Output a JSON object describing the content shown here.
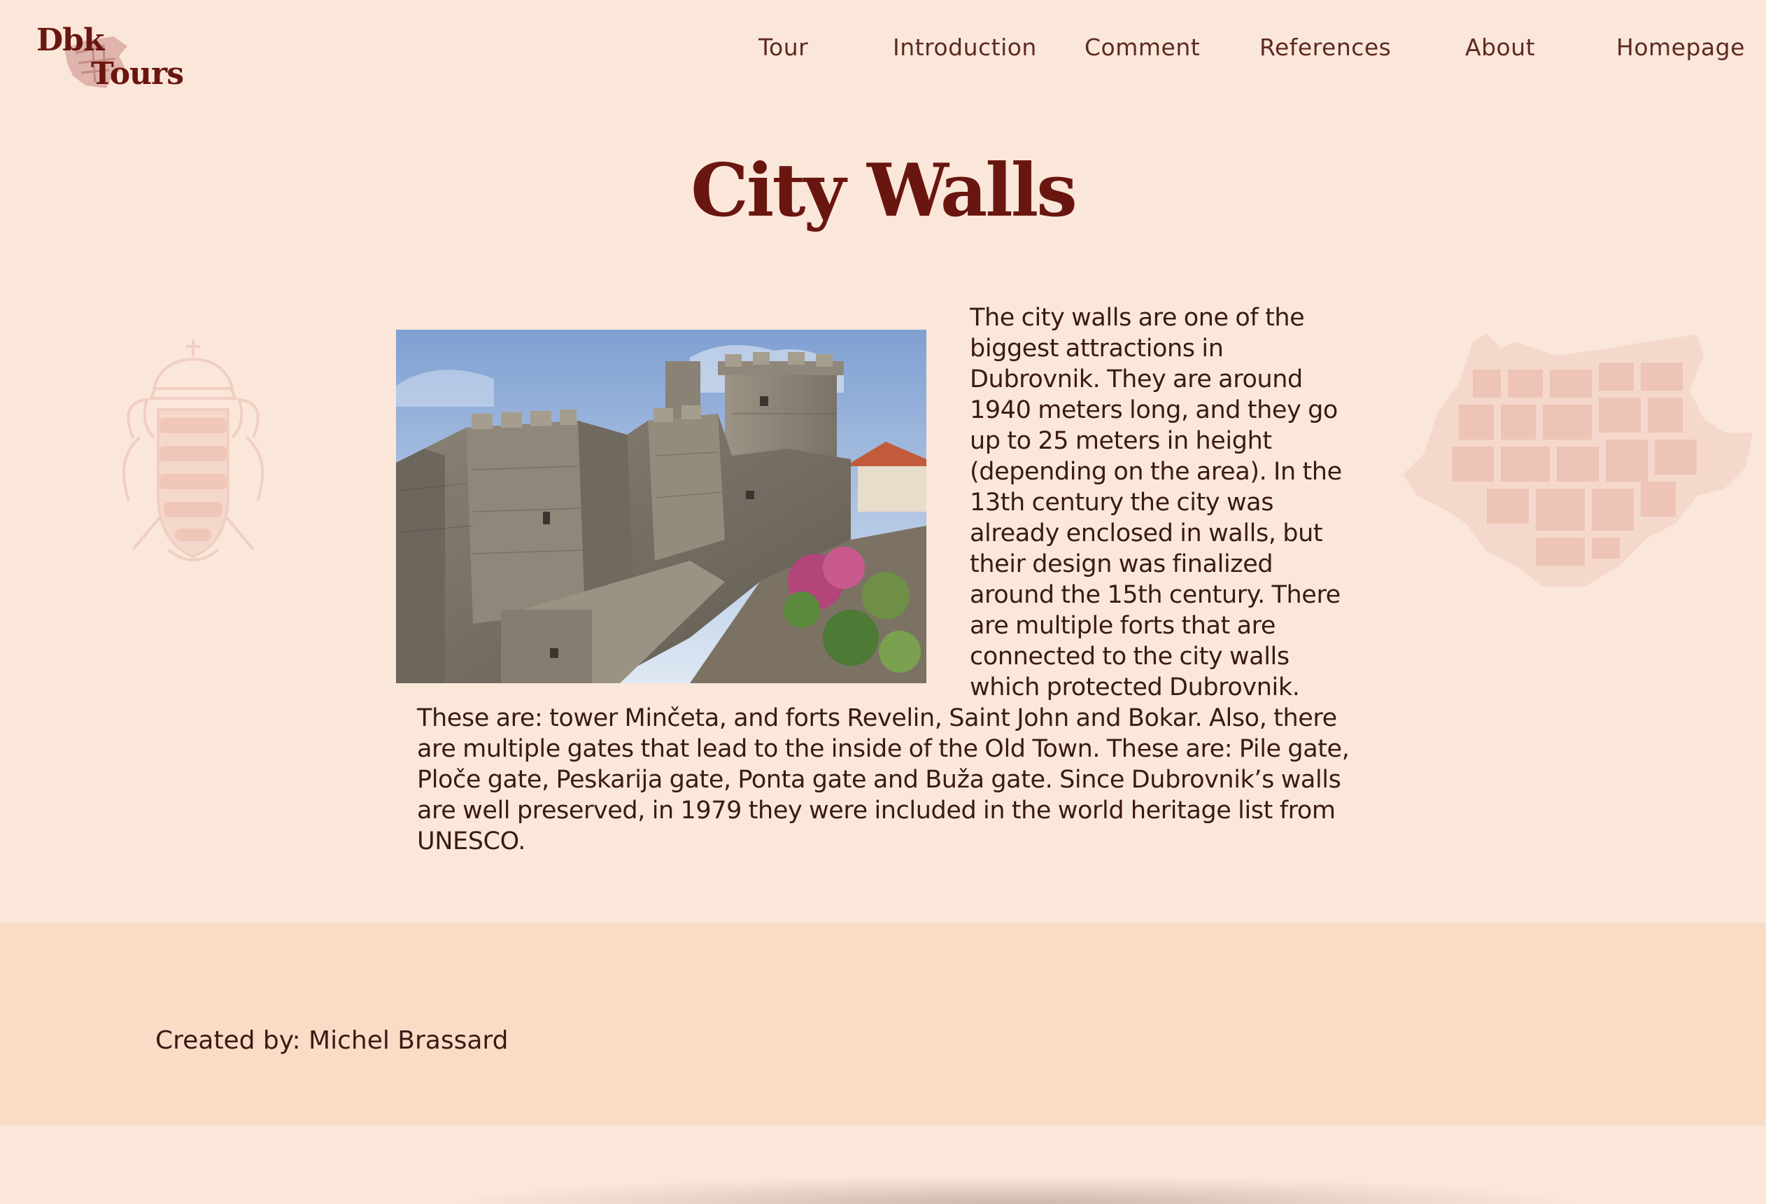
{
  "brand": {
    "line1": "Dbk",
    "line2": "Tours",
    "color": "#6a1610"
  },
  "nav": [
    {
      "label": "Tour"
    },
    {
      "label": "Introduction"
    },
    {
      "label": "Comment"
    },
    {
      "label": "References"
    },
    {
      "label": "About"
    },
    {
      "label": "Homepage"
    }
  ],
  "page": {
    "title": "City Walls",
    "body": "The city walls are one of the biggest attractions in Dubrovnik. They are around 1940 meters long, and they go up to 25 meters in height (depending on the area). In the 13th century the city was already enclosed in walls, but their design was finalized around the 15th century. There are multiple forts that are connected to the city walls which protected Dubrovnik. These are: tower Minčeta, and forts Revelin, Saint John and Bokar. Also, there are multiple gates that lead to the inside of the Old Town. These are: Pile gate, Ploče gate, Peskarija gate, Ponta gate and Buža gate. Since Dubrovnik’s walls are well preserved, in 1979 they were included in the world heritage list from UNESCO."
  },
  "decor": {
    "left": "coat-of-arms-icon",
    "right": "city-map-icon",
    "photo": "city-walls-photo"
  },
  "footer": {
    "credit": "Created by: Michel Brassard"
  },
  "colors": {
    "background": "#fbe7da",
    "footer": "#f8dcc6",
    "title": "#6a1610",
    "decor": "#f0cfc2"
  }
}
